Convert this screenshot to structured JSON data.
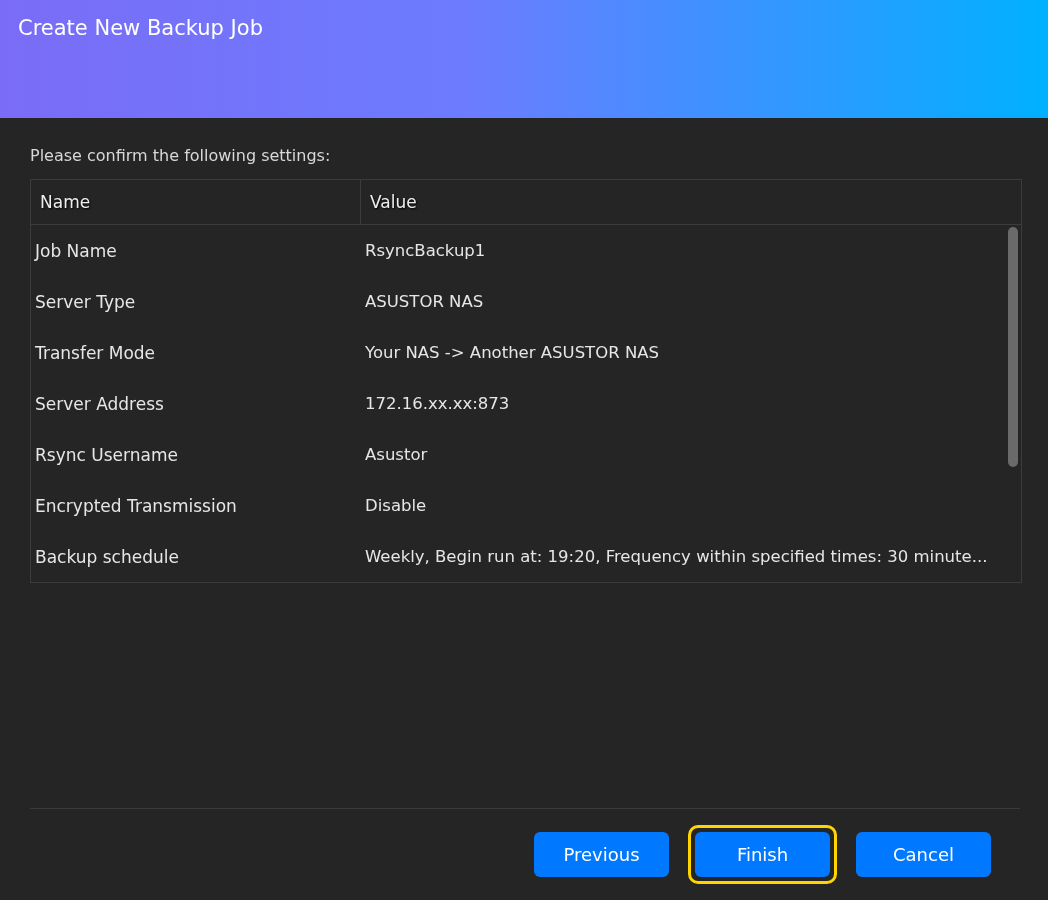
{
  "window": {
    "title": "Create New Backup Job"
  },
  "instruction": "Please confirm the following settings:",
  "table": {
    "columns": [
      "Name",
      "Value"
    ],
    "rows": [
      {
        "name": "Job Name",
        "value": "RsyncBackup1"
      },
      {
        "name": "Server Type",
        "value": "ASUSTOR NAS"
      },
      {
        "name": "Transfer Mode",
        "value": "Your NAS -> Another ASUSTOR NAS"
      },
      {
        "name": "Server Address",
        "value": "172.16.xx.xx:873"
      },
      {
        "name": "Rsync Username",
        "value": "Asustor"
      },
      {
        "name": "Encrypted Transmission",
        "value": "Disable"
      },
      {
        "name": "Backup schedule",
        "value": "Weekly, Begin run at: 19:20, Frequency within specified times: 30 minute..."
      }
    ]
  },
  "buttons": [
    {
      "label": "Previous",
      "highlighted": false
    },
    {
      "label": "Finish",
      "highlighted": true
    },
    {
      "label": "Cancel",
      "highlighted": false
    }
  ]
}
